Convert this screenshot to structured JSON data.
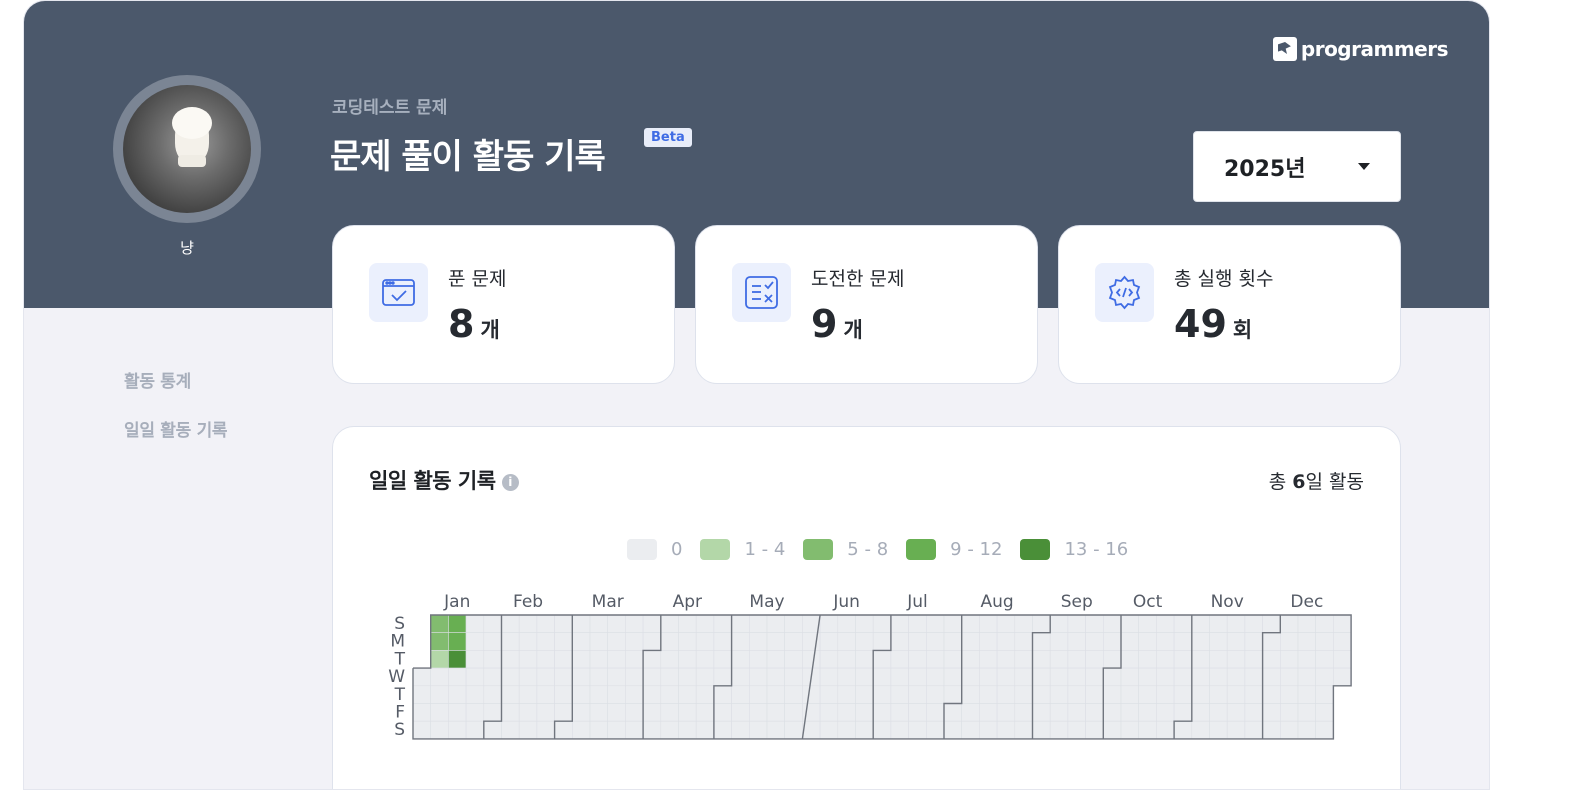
{
  "brand": {
    "logo_text": "programmers"
  },
  "profile": {
    "username": "냥"
  },
  "header": {
    "subtitle": "코딩테스트 문제",
    "title": "문제 풀이 활동 기록",
    "badge": "Beta",
    "year_select": {
      "selected": "2025년"
    }
  },
  "stats": [
    {
      "label": "푼 문제",
      "value": "8",
      "unit": "개",
      "icon": "browser-check-icon"
    },
    {
      "label": "도전한 문제",
      "value": "9",
      "unit": "개",
      "icon": "checklist-icon"
    },
    {
      "label": "총 실행 횟수",
      "value": "49",
      "unit": "회",
      "icon": "code-gear-icon"
    }
  ],
  "sidebar": {
    "items": [
      {
        "label": "활동 통계"
      },
      {
        "label": "일일 활동 기록"
      }
    ]
  },
  "activity": {
    "title": "일일 활동 기록",
    "info_icon": "i",
    "total_prefix": "총 ",
    "total_days": "6",
    "total_suffix": "일 활동",
    "legend": [
      {
        "label": "0",
        "color": "#ebedf0"
      },
      {
        "label": "1 - 4",
        "color": "#b3d7a8"
      },
      {
        "label": "5 - 8",
        "color": "#82bc6f"
      },
      {
        "label": "9 - 12",
        "color": "#68af52"
      },
      {
        "label": "13 - 16",
        "color": "#4a8f38"
      }
    ],
    "months": [
      "Jan",
      "Feb",
      "Mar",
      "Apr",
      "May",
      "Jun",
      "Jul",
      "Aug",
      "Sep",
      "Oct",
      "Nov",
      "Dec"
    ],
    "weekdays": [
      "S",
      "M",
      "T",
      "W",
      "T",
      "F",
      "S"
    ],
    "active_days": [
      {
        "date": "2025-01-05",
        "level": 2
      },
      {
        "date": "2025-01-06",
        "level": 2
      },
      {
        "date": "2025-01-07",
        "level": 1
      },
      {
        "date": "2025-01-12",
        "level": 3
      },
      {
        "date": "2025-01-13",
        "level": 3
      },
      {
        "date": "2025-01-14",
        "level": 4
      }
    ]
  }
}
